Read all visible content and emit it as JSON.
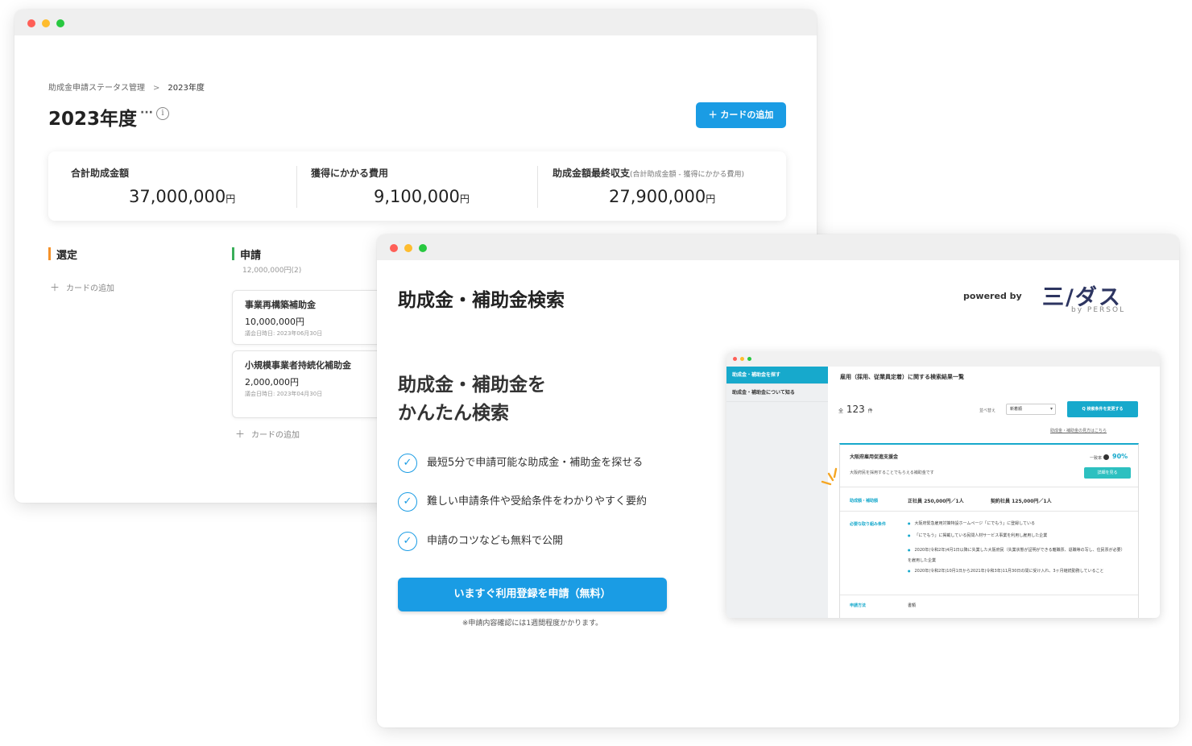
{
  "window1": {
    "breadcrumb": {
      "root": "助成金申請ステータス管理",
      "separator": ">",
      "current": "2023年度"
    },
    "title": "2023年度",
    "more_label": "···",
    "info_label": "i",
    "add_card_button": "＋ カードの追加",
    "summary": [
      {
        "label": "合計助成金額",
        "note": "",
        "value": "37,000,000",
        "unit": "円"
      },
      {
        "label": "獲得にかかる費用",
        "note": "",
        "value": "9,100,000",
        "unit": "円"
      },
      {
        "label": "助成金額最終収支",
        "note": "(合計助成金額 - 獲得にかかる費用)",
        "value": "27,900,000",
        "unit": "円"
      }
    ],
    "columns": [
      {
        "title": "選定",
        "color": "#f5922a",
        "add_label": "カードの追加"
      },
      {
        "title": "申請",
        "color": "#3aae5a",
        "subtitle": "12,000,000円(2)",
        "add_label": "カードの追加",
        "cards": [
          {
            "title": "事業再構築補助金",
            "amount": "10,000,000円",
            "date": "議会日時日: 2023年06月30日"
          },
          {
            "title": "小規模事業者持続化補助金",
            "amount": "2,000,000円",
            "date": "議会日時日: 2023年04月30日"
          }
        ]
      }
    ]
  },
  "window2": {
    "title": "助成金・補助金検索",
    "powered_by": "powered by",
    "logo": "三/ダス",
    "logo_sub": "by PERSOL",
    "hero_line1": "助成金・補助金を",
    "hero_line2": "かんたん検索",
    "features": [
      "最短5分で申請可能な助成金・補助金を探せる",
      "難しい申請条件や受給条件をわかりやすく要約",
      "申請のコツなども無料で公開"
    ],
    "cta_button": "いますぐ利用登録を申請（無料）",
    "cta_note": "※申請内容確認には1週間程度かかります。",
    "preview": {
      "sidebar": [
        "助成金・補助金を探す",
        "助成金・補助金について知る"
      ],
      "header": "雇用（採用、従業員定着）に関する検索結果一覧",
      "count_prefix": "全",
      "count": "123",
      "count_unit": "件",
      "sort_label": "並べ替え",
      "sort_value": "新着順",
      "search_button": "Q 検索条件を変更する",
      "help_link": "助成金・補助金の見方はこちら",
      "result": {
        "name": "大阪府雇用促進支援金",
        "rate_label": "一致率",
        "rate": "90%",
        "desc": "大阪府民を採用することでもらえる補助金です",
        "detail_button": "詳細を見る",
        "amount_label": "助成額・補助額",
        "amount_1": "正社員 250,000円／1人",
        "amount_2": "契約社員 125,000円／1人",
        "req_label": "必要な取り組み条件",
        "requirements": [
          "大阪府緊急雇用対策特設ホームページ「にでもう」に登録している",
          "「にでもう」に掲載している民間人材サービス事業を利用し雇用した企業",
          "2020年(令和2年)4月1日以降に失業した大阪府民（失業状態が証明ができる離職票、退職等の写し、住民票が必要）を雇用した企業",
          "2020年(令和2年)10月1日から2021年(令和3年)11月30日の間に受け入れ、3ヶ月継続勤務していること"
        ],
        "method_label": "申請方法",
        "method_value": "書類"
      }
    }
  },
  "colors": {
    "accent": "#1a9ce4",
    "teal": "#17a9cc",
    "orange": "#f5922a",
    "green": "#3aae5a"
  }
}
